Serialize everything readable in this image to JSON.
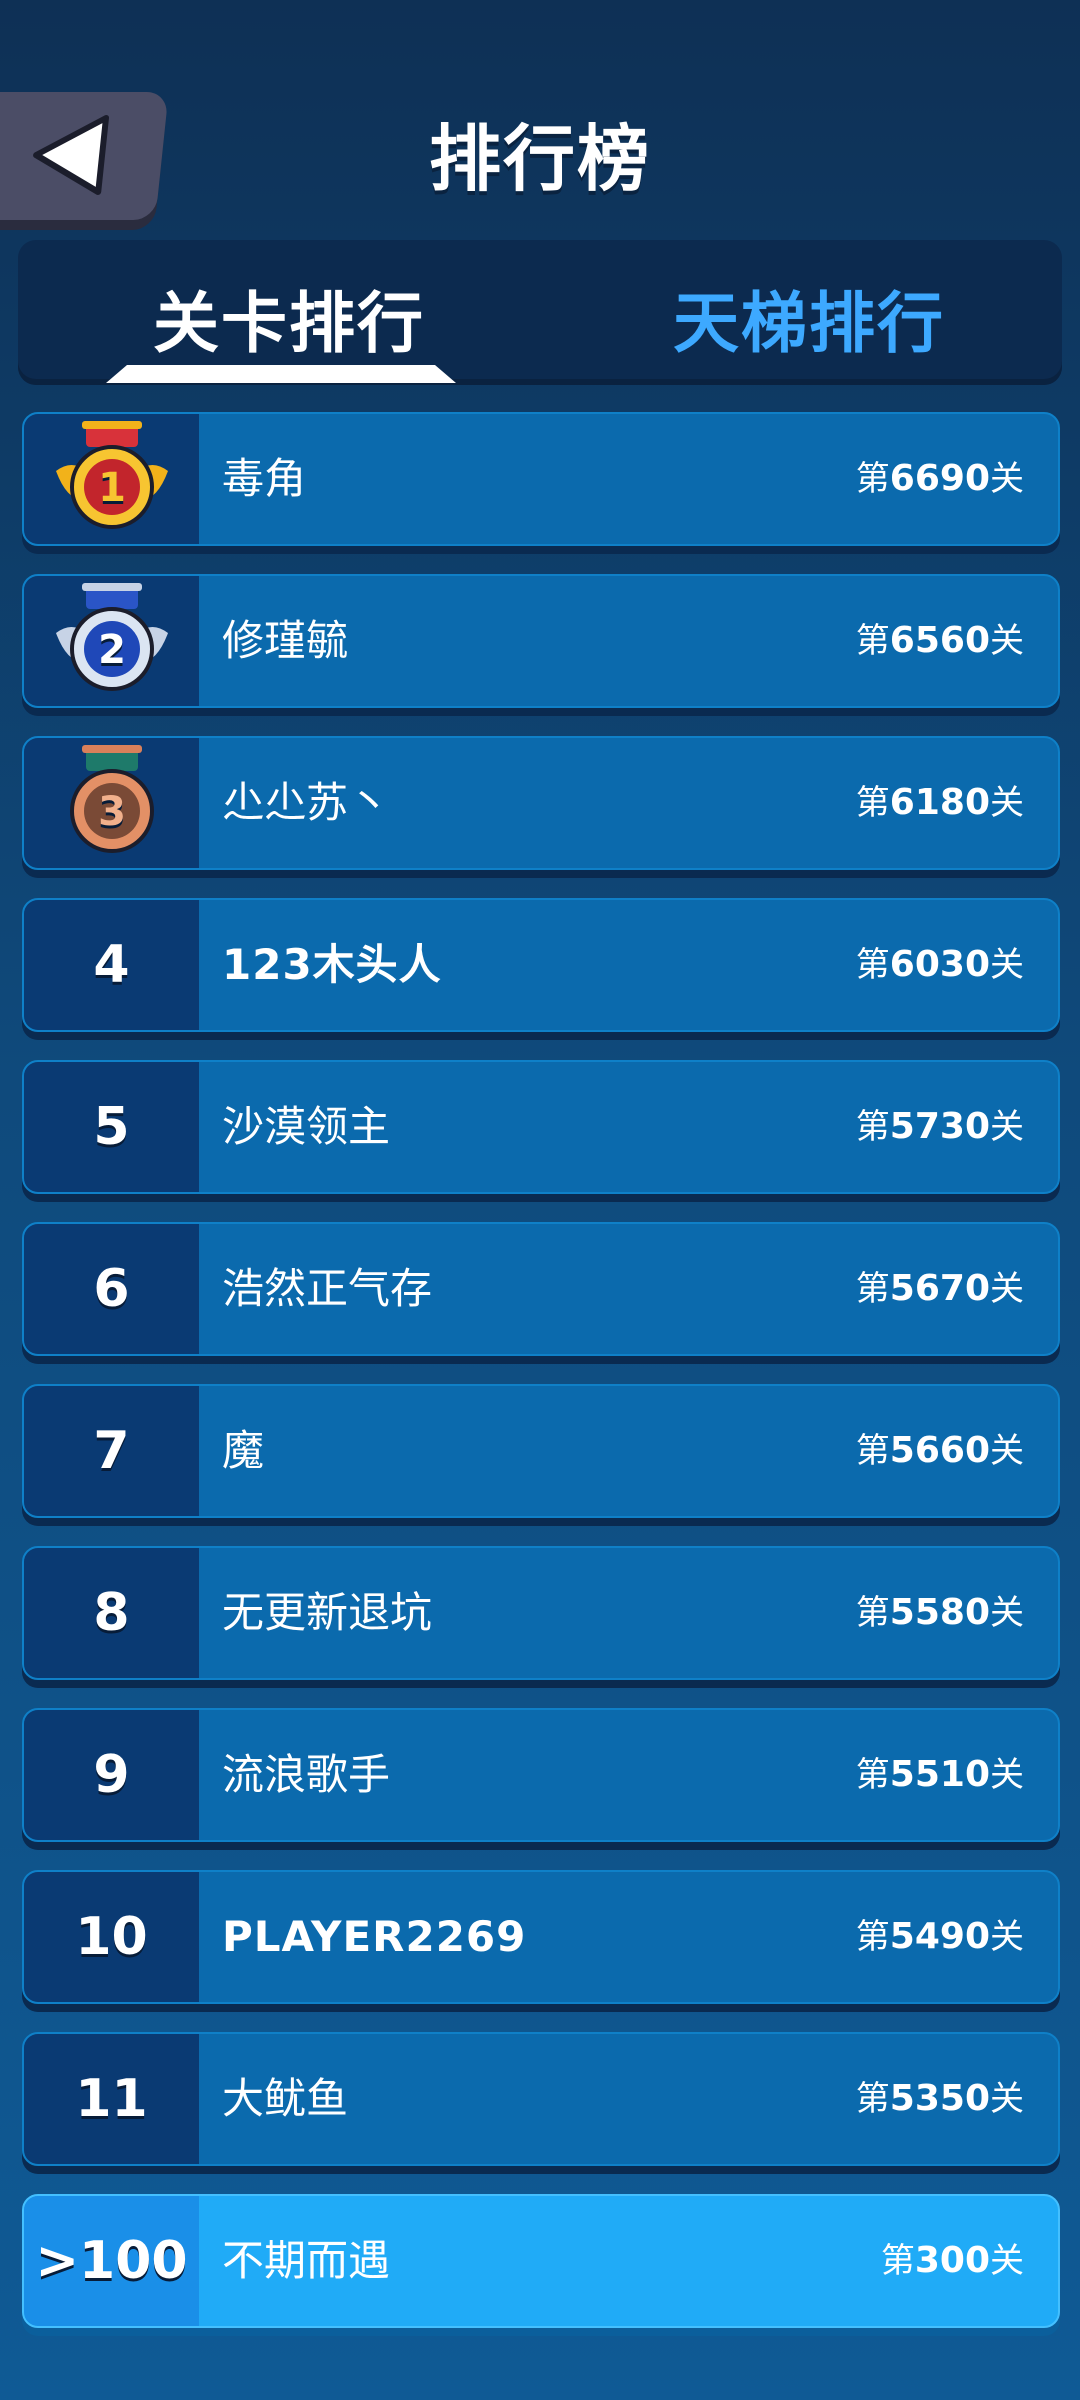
{
  "header": {
    "title": "排行榜",
    "back_icon": "back-arrow-icon"
  },
  "tabs": [
    {
      "label": "关卡排行",
      "active": true
    },
    {
      "label": "天梯排行",
      "active": false
    }
  ],
  "colors": {
    "accent": "#3da9ff",
    "row_bg": "#0b6aad",
    "rank_bg": "#0a3a73",
    "self_row_bg": "#20abf7",
    "gold": "#f2b21a",
    "silver": "#c7d3e6",
    "bronze": "#d9805a"
  },
  "leaderboard": {
    "level_prefix": "第",
    "level_suffix": "关",
    "rows": [
      {
        "rank": "1",
        "medal": "gold-medal-icon",
        "name": "毒角",
        "level": "6690"
      },
      {
        "rank": "2",
        "medal": "silver-medal-icon",
        "name": "修瑾毓",
        "level": "6560"
      },
      {
        "rank": "3",
        "medal": "bronze-medal-icon",
        "name": "尐尐苏丶",
        "level": "6180"
      },
      {
        "rank": "4",
        "name": "123木头人",
        "level": "6030"
      },
      {
        "rank": "5",
        "name": "沙漠领主",
        "level": "5730"
      },
      {
        "rank": "6",
        "name": "浩然正气存",
        "level": "5670"
      },
      {
        "rank": "7",
        "name": "魔",
        "level": "5660"
      },
      {
        "rank": "8",
        "name": "无更新退坑",
        "level": "5580"
      },
      {
        "rank": "9",
        "name": "流浪歌手",
        "level": "5510"
      },
      {
        "rank": "10",
        "name": "PLAYER2269",
        "level": "5490"
      },
      {
        "rank": "11",
        "name": "大鱿鱼",
        "level": "5350"
      }
    ],
    "self": {
      "rank": ">100",
      "name": "不期而遇",
      "level": "300"
    }
  }
}
